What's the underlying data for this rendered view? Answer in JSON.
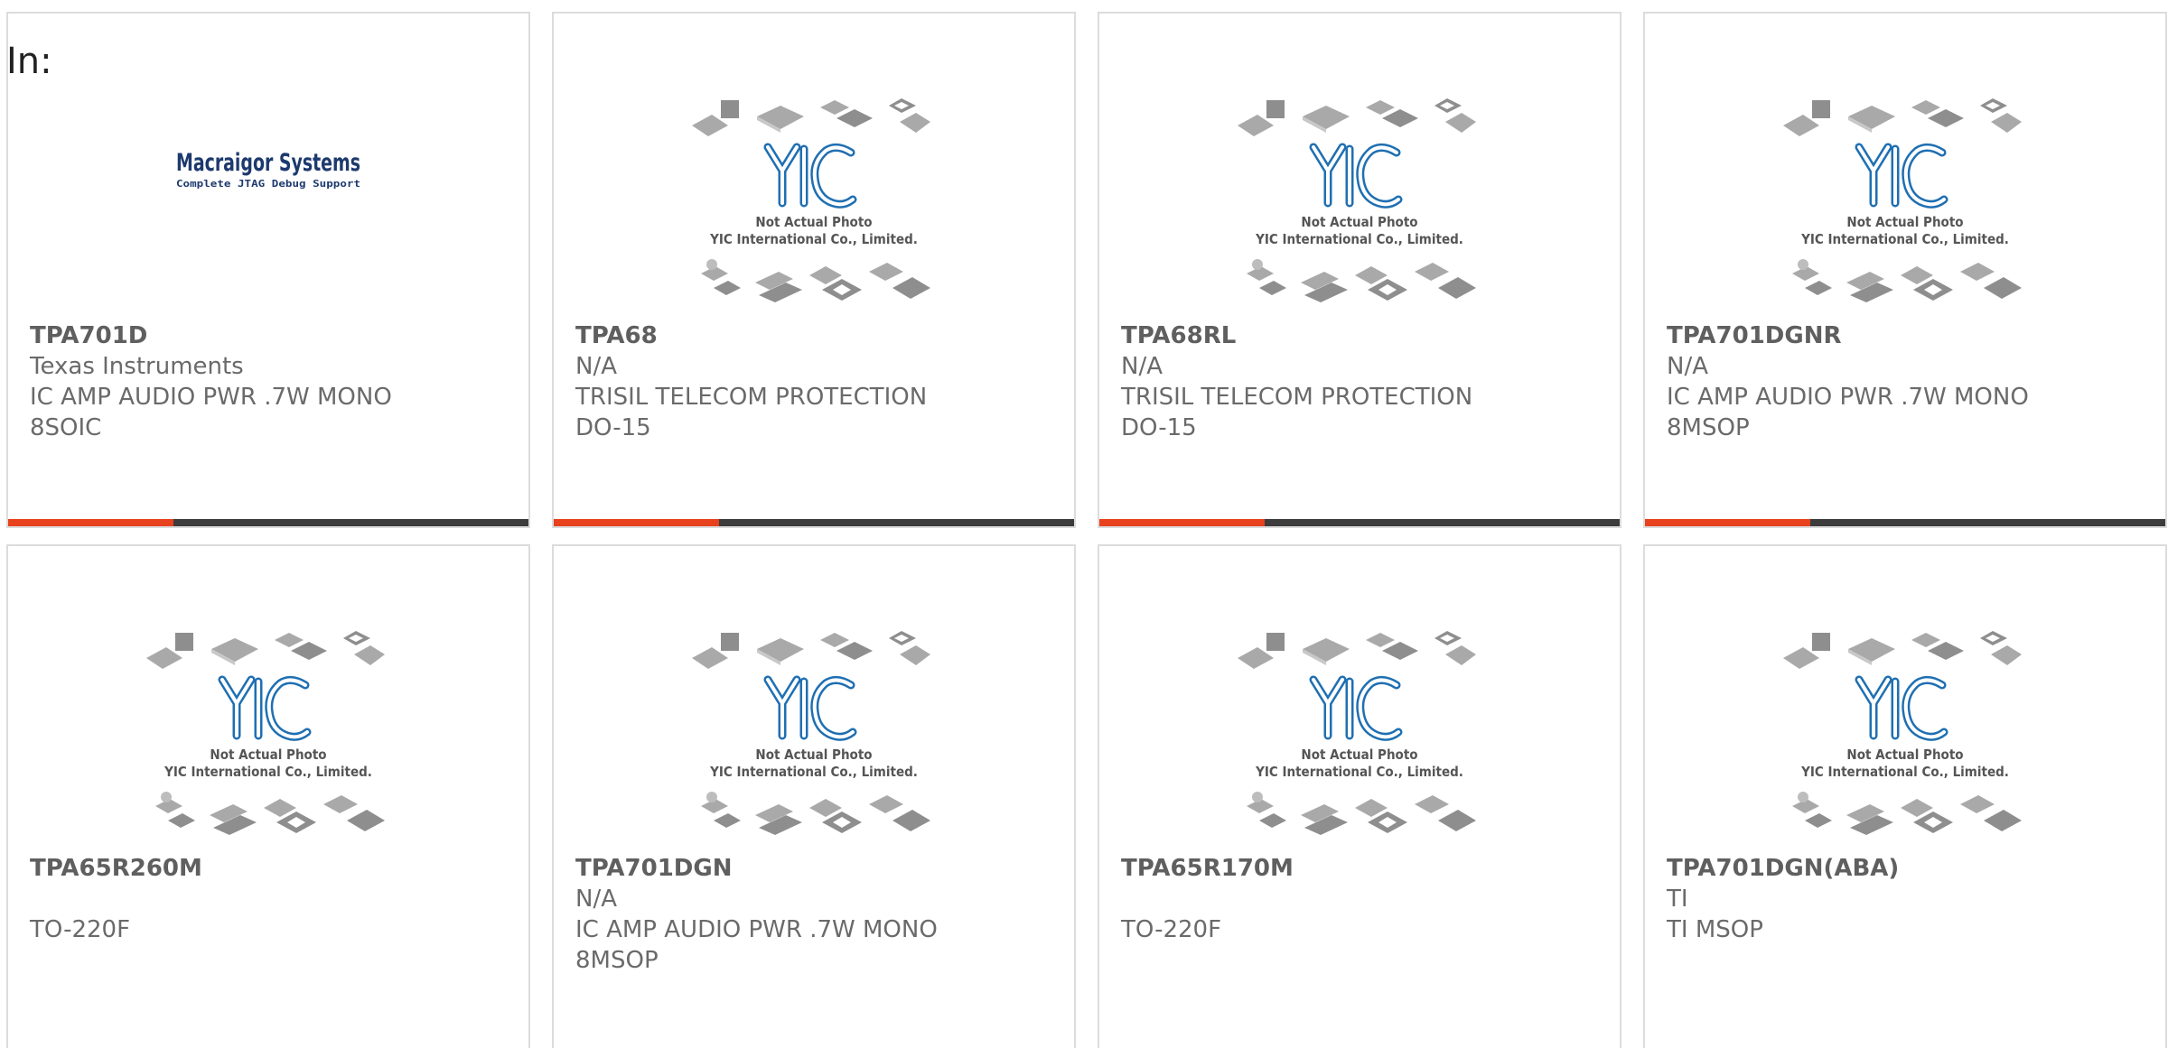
{
  "header": {
    "label": "In:"
  },
  "colors": {
    "accent": "#e8411e",
    "bar_dark": "#3c3c3c",
    "card_border": "#dcdcdc",
    "text": "#6a6a6a",
    "yic_blue": "#1f6fb2",
    "macraigor_navy": "#1d3a6e"
  },
  "placeholder": {
    "caption1": "Not Actual Photo",
    "caption2": "YIC International Co., Limited.",
    "logo_text": "YIC"
  },
  "macraigor": {
    "title": "Macraigor Systems",
    "tagline": "Complete JTAG Debug Support"
  },
  "products": [
    {
      "part": "TPA701D",
      "manufacturer": "Texas Instruments",
      "description": "IC AMP AUDIO PWR .7W MONO",
      "package": "8SOIC",
      "image": "macraigor-logo",
      "bar": true
    },
    {
      "part": "TPA68",
      "manufacturer": "N/A",
      "description": "TRISIL TELECOM PROTECTION",
      "package": "DO-15",
      "image": "yic-placeholder",
      "bar": true
    },
    {
      "part": "TPA68RL",
      "manufacturer": "N/A",
      "description": "TRISIL TELECOM PROTECTION",
      "package": "DO-15",
      "image": "yic-placeholder",
      "bar": true
    },
    {
      "part": "TPA701DGNR",
      "manufacturer": "N/A",
      "description": "IC AMP AUDIO PWR .7W MONO",
      "package": "8MSOP",
      "image": "yic-placeholder",
      "bar": true
    },
    {
      "part": "TPA65R260M",
      "manufacturer": "",
      "description": "TO-220F",
      "package": "",
      "image": "yic-placeholder",
      "bar": false
    },
    {
      "part": "TPA701DGN",
      "manufacturer": "N/A",
      "description": "IC AMP AUDIO PWR .7W MONO",
      "package": "8MSOP",
      "image": "yic-placeholder",
      "bar": false
    },
    {
      "part": "TPA65R170M",
      "manufacturer": "",
      "description": "TO-220F",
      "package": "",
      "image": "yic-placeholder",
      "bar": false
    },
    {
      "part": "TPA701DGN(ABA)",
      "manufacturer": "TI",
      "description": "TI MSOP",
      "package": "",
      "image": "yic-placeholder",
      "bar": false
    }
  ]
}
